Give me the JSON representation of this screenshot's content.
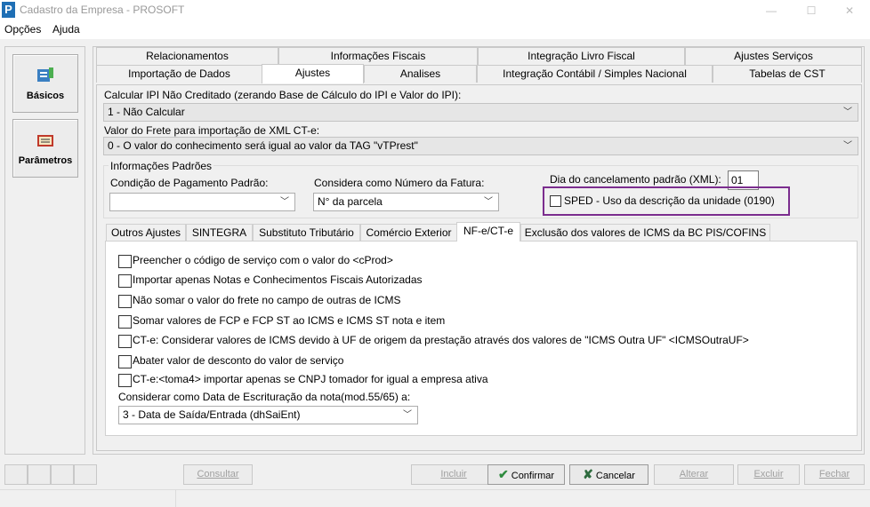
{
  "window": {
    "title": "Cadastro da Empresa - PROSOFT",
    "icon_letter": "P",
    "controls": [
      "—",
      "☐",
      "✕"
    ]
  },
  "menu": {
    "items": [
      "Opções",
      "Ajuda"
    ]
  },
  "sidebar": {
    "items": [
      {
        "label": "Básicos",
        "icon": "basicos-icon"
      },
      {
        "label": "Parâmetros",
        "icon": "parametros-icon"
      }
    ]
  },
  "tabs": {
    "row1": [
      "Relacionamentos",
      "Informações Fiscais",
      "Integração Livro Fiscal",
      "Ajustes Serviços"
    ],
    "row2": [
      "Importação de Dados",
      "Ajustes",
      "Analises",
      "Integração Contábil / Simples Nacional",
      "Tabelas de CST"
    ],
    "active": "Ajustes"
  },
  "form": {
    "ipi_label": "Calcular IPI Não Creditado (zerando Base de Cálculo do IPI e Valor do IPI):",
    "ipi_value": "1 - Não Calcular",
    "frete_label": "Valor do Frete para importação de XML CT-e:",
    "frete_value": "0 - O valor do conhecimento será igual ao valor da TAG \"vTPrest\"",
    "group_title": "Informações Padrões",
    "pagamento_label": "Condição de Pagamento Padrão:",
    "pagamento_value": "",
    "fatura_label": "Considera como Número da Fatura:",
    "fatura_value": "N° da parcela",
    "cancel_label": "Dia do cancelamento padrão (XML):",
    "cancel_value": "01",
    "sped_label": "SPED - Uso da descrição da unidade (0190)",
    "sped_checked": false
  },
  "subtabs": {
    "items": [
      "Outros Ajustes",
      "SINTEGRA",
      "Substituto Tributário",
      "Comércio Exterior",
      "NF-e/CT-e",
      "Exclusão dos valores de ICMS da BC PIS/COFINS"
    ],
    "active": "NF-e/CT-e"
  },
  "nfe": {
    "options": [
      "Preencher o código de serviço com o valor do <cProd>",
      "Importar apenas Notas e Conhecimentos Fiscais Autorizadas",
      "Não somar o valor do frete no campo de outras de ICMS",
      "Somar valores de FCP e FCP ST ao ICMS e ICMS ST nota e item",
      "CT-e: Considerar valores de ICMS devido à UF de origem da prestação através dos valores de \"ICMS Outra UF\" <ICMSOutraUF>",
      "Abater valor de desconto do valor de serviço",
      "CT-e:<toma4> importar apenas se CNPJ tomador for igual a empresa ativa"
    ],
    "escrituracao_label": "Considerar como Data de Escrituração da nota(mod.55/65) a:",
    "escrituracao_value": "3 -  Data de Saída/Entrada (dhSaiEnt)"
  },
  "buttons": {
    "consultar": "Consultar",
    "incluir": "Incluir",
    "confirmar": "Confirmar",
    "cancelar": "Cancelar",
    "alterar": "Alterar",
    "excluir": "Excluir",
    "fechar": "Fechar"
  },
  "colors": {
    "highlight": "#7b2d8e",
    "confirm_icon": "#2e8b3e",
    "cancel_icon": "#2e6b3e"
  }
}
